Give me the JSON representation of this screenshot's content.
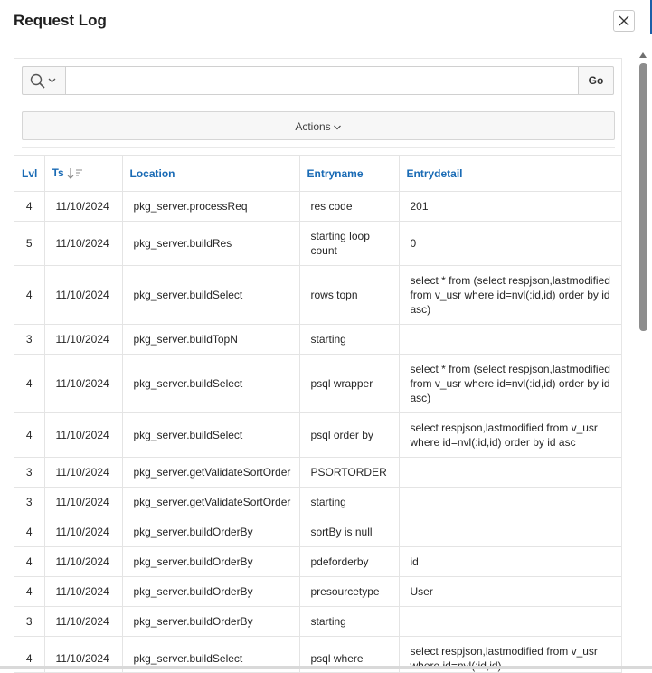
{
  "dialog": {
    "title": "Request Log",
    "close_icon": "close-icon"
  },
  "toolbar": {
    "search_icon": "search-icon",
    "search_value": "",
    "go_label": "Go",
    "actions_label": "Actions"
  },
  "table": {
    "columns": [
      "Lvl",
      "Ts",
      "Location",
      "Entryname",
      "Entrydetail"
    ],
    "sort_column": "Ts",
    "sort_direction": "descending",
    "rows": [
      {
        "lvl": "4",
        "ts": "11/10/2024",
        "location": "pkg_server.processReq",
        "entryname": "res code",
        "entrydetail": "201"
      },
      {
        "lvl": "5",
        "ts": "11/10/2024",
        "location": "pkg_server.buildRes",
        "entryname": "starting loop count",
        "entrydetail": "0"
      },
      {
        "lvl": "4",
        "ts": "11/10/2024",
        "location": "pkg_server.buildSelect",
        "entryname": "rows topn",
        "entrydetail": "select * from (select respjson,lastmodified from v_usr where id=nvl(:id,id) order by id asc)"
      },
      {
        "lvl": "3",
        "ts": "11/10/2024",
        "location": "pkg_server.buildTopN",
        "entryname": "starting",
        "entrydetail": ""
      },
      {
        "lvl": "4",
        "ts": "11/10/2024",
        "location": "pkg_server.buildSelect",
        "entryname": "psql wrapper",
        "entrydetail": "select * from (select respjson,lastmodified from v_usr where id=nvl(:id,id) order by id asc)"
      },
      {
        "lvl": "4",
        "ts": "11/10/2024",
        "location": "pkg_server.buildSelect",
        "entryname": "psql order by",
        "entrydetail": "select respjson,lastmodified from v_usr where id=nvl(:id,id) order by id asc"
      },
      {
        "lvl": "3",
        "ts": "11/10/2024",
        "location": "pkg_server.getValidateSortOrder",
        "entryname": "PSORTORDER",
        "entrydetail": ""
      },
      {
        "lvl": "3",
        "ts": "11/10/2024",
        "location": "pkg_server.getValidateSortOrder",
        "entryname": "starting",
        "entrydetail": ""
      },
      {
        "lvl": "4",
        "ts": "11/10/2024",
        "location": "pkg_server.buildOrderBy",
        "entryname": "sortBy is null",
        "entrydetail": ""
      },
      {
        "lvl": "4",
        "ts": "11/10/2024",
        "location": "pkg_server.buildOrderBy",
        "entryname": "pdeforderby",
        "entrydetail": "id"
      },
      {
        "lvl": "4",
        "ts": "11/10/2024",
        "location": "pkg_server.buildOrderBy",
        "entryname": "presourcetype",
        "entrydetail": "User"
      },
      {
        "lvl": "3",
        "ts": "11/10/2024",
        "location": "pkg_server.buildOrderBy",
        "entryname": "starting",
        "entrydetail": ""
      },
      {
        "lvl": "4",
        "ts": "11/10/2024",
        "location": "pkg_server.buildSelect",
        "entryname": "psql where",
        "entrydetail": "select respjson,lastmodified from v_usr where id=nvl(:id,id)"
      }
    ]
  },
  "colors": {
    "header_link": "#1a6bb5",
    "accent": "#1b5fa8"
  }
}
